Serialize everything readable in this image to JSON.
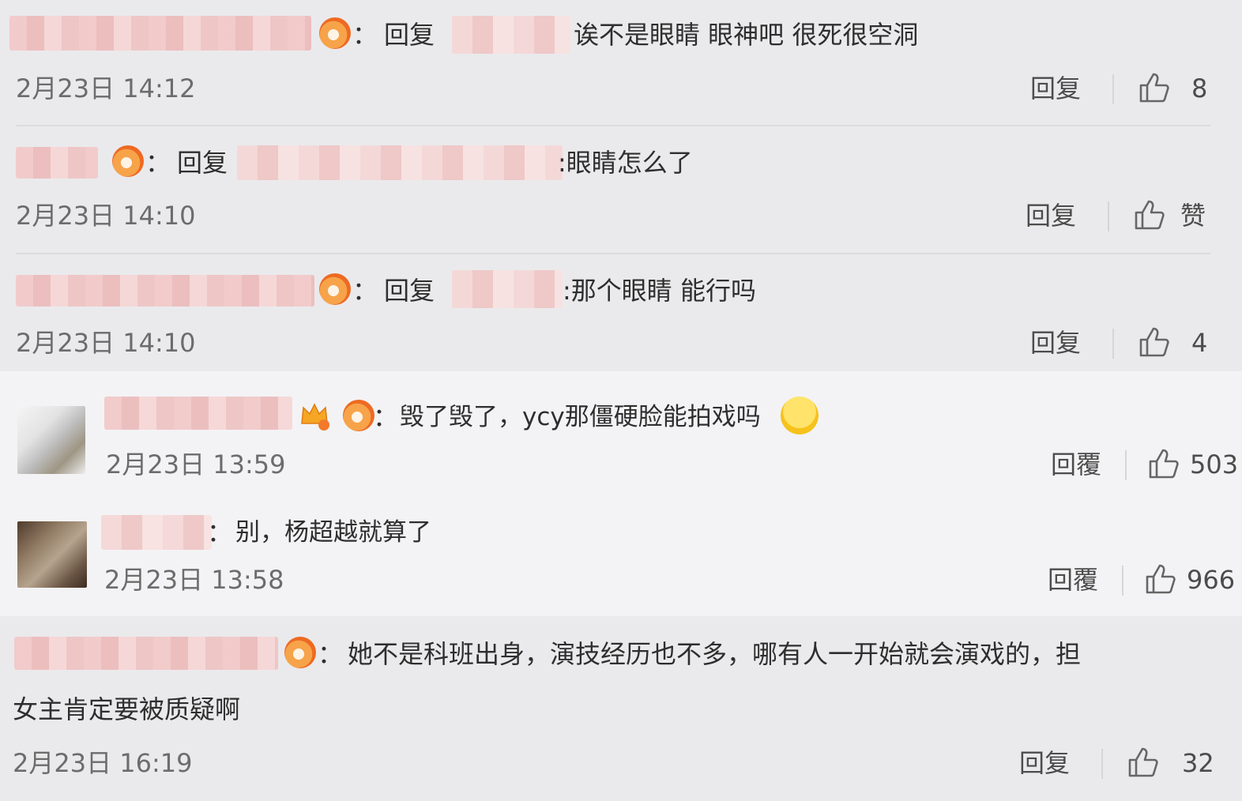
{
  "comments": [
    {
      "reply_prefix": "回复",
      "text": "诶不是眼睛 眼神吧 很死很空洞",
      "time": "2月23日 14:12",
      "reply_label": "回复",
      "likes": "8"
    },
    {
      "reply_prefix": "回复",
      "text": ":眼睛怎么了",
      "time": "2月23日 14:10",
      "reply_label": "回复",
      "likes": "赞"
    },
    {
      "reply_prefix": "回复",
      "text": ":那个眼睛 能行吗",
      "time": "2月23日 14:10",
      "reply_label": "回复",
      "likes": "4"
    },
    {
      "text": "毁了毁了，ycy那僵硬脸能拍戏吗",
      "time": "2月23日 13:59",
      "reply_label": "回覆",
      "likes": "503"
    },
    {
      "text": "别，杨超越就算了",
      "time": "2月23日 13:58",
      "reply_label": "回覆",
      "likes": "966"
    },
    {
      "text_line1": "她不是科班出身，演技经历也不多，哪有人一开始就会演戏的，担",
      "text_line2": "女主肯定要被质疑啊",
      "time": "2月23日 16:19",
      "reply_label": "回复",
      "likes": "32"
    }
  ],
  "colon": "：",
  "icons": {
    "badge": "fire-badge-icon",
    "like": "thumb-up-icon",
    "vip": "crown-badge-icon",
    "emoji": "cry-emoji-icon"
  }
}
